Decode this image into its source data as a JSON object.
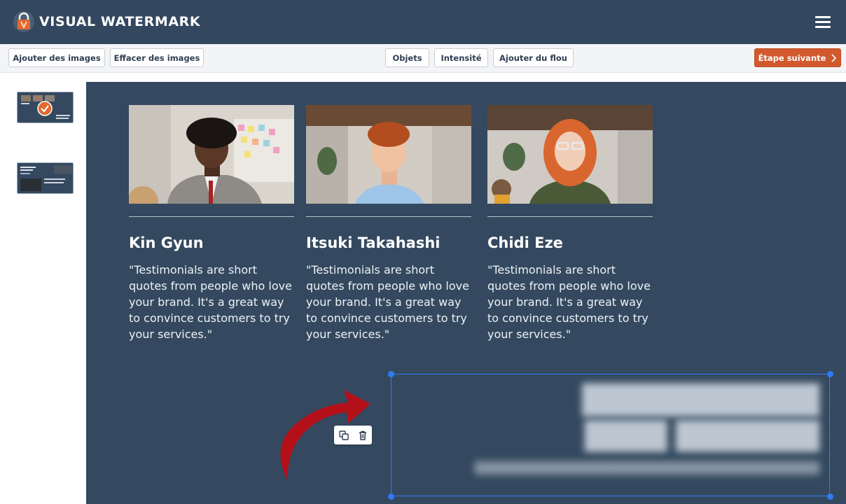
{
  "app": {
    "title": "VISUAL WATERMARK",
    "logo_icon": "padlock-logo-icon",
    "menu_icon": "hamburger-menu-icon"
  },
  "toolbar": {
    "add_images": "Ajouter des images",
    "clear_images": "Effacer des images",
    "objects": "Objets",
    "intensity": "Intensité",
    "add_blur": "Ajouter du flou",
    "next_step": "Étape suivante",
    "next_icon": "chevron-right-icon"
  },
  "sidebar": {
    "thumbnails": [
      {
        "selected": true,
        "check_icon": "check-circle-icon"
      },
      {
        "selected": false
      }
    ]
  },
  "canvas": {
    "cards": [
      {
        "name": "Kin Gyun",
        "quote": "\"Testimonials are short quotes from people who love your brand. It's a great way to convince customers to try your services.\""
      },
      {
        "name": "Itsuki Takahashi",
        "quote": "\"Testimonials are short quotes from people who love your brand. It's a great way to convince customers to try your services.\""
      },
      {
        "name": "Chidi Eze",
        "quote": "\"Testimonials are short quotes from people who love your brand. It's a great way to convince customers to try your services.\""
      }
    ],
    "blurred_area": {
      "icons": [
        "duplicate-icon",
        "trash-icon"
      ]
    },
    "arrow_icon": "red-curved-arrow-icon"
  },
  "colors": {
    "header_bg": "#33475f",
    "canvas_bg": "#34495f",
    "accent": "#d2592e",
    "selection": "#2f7bf5"
  }
}
